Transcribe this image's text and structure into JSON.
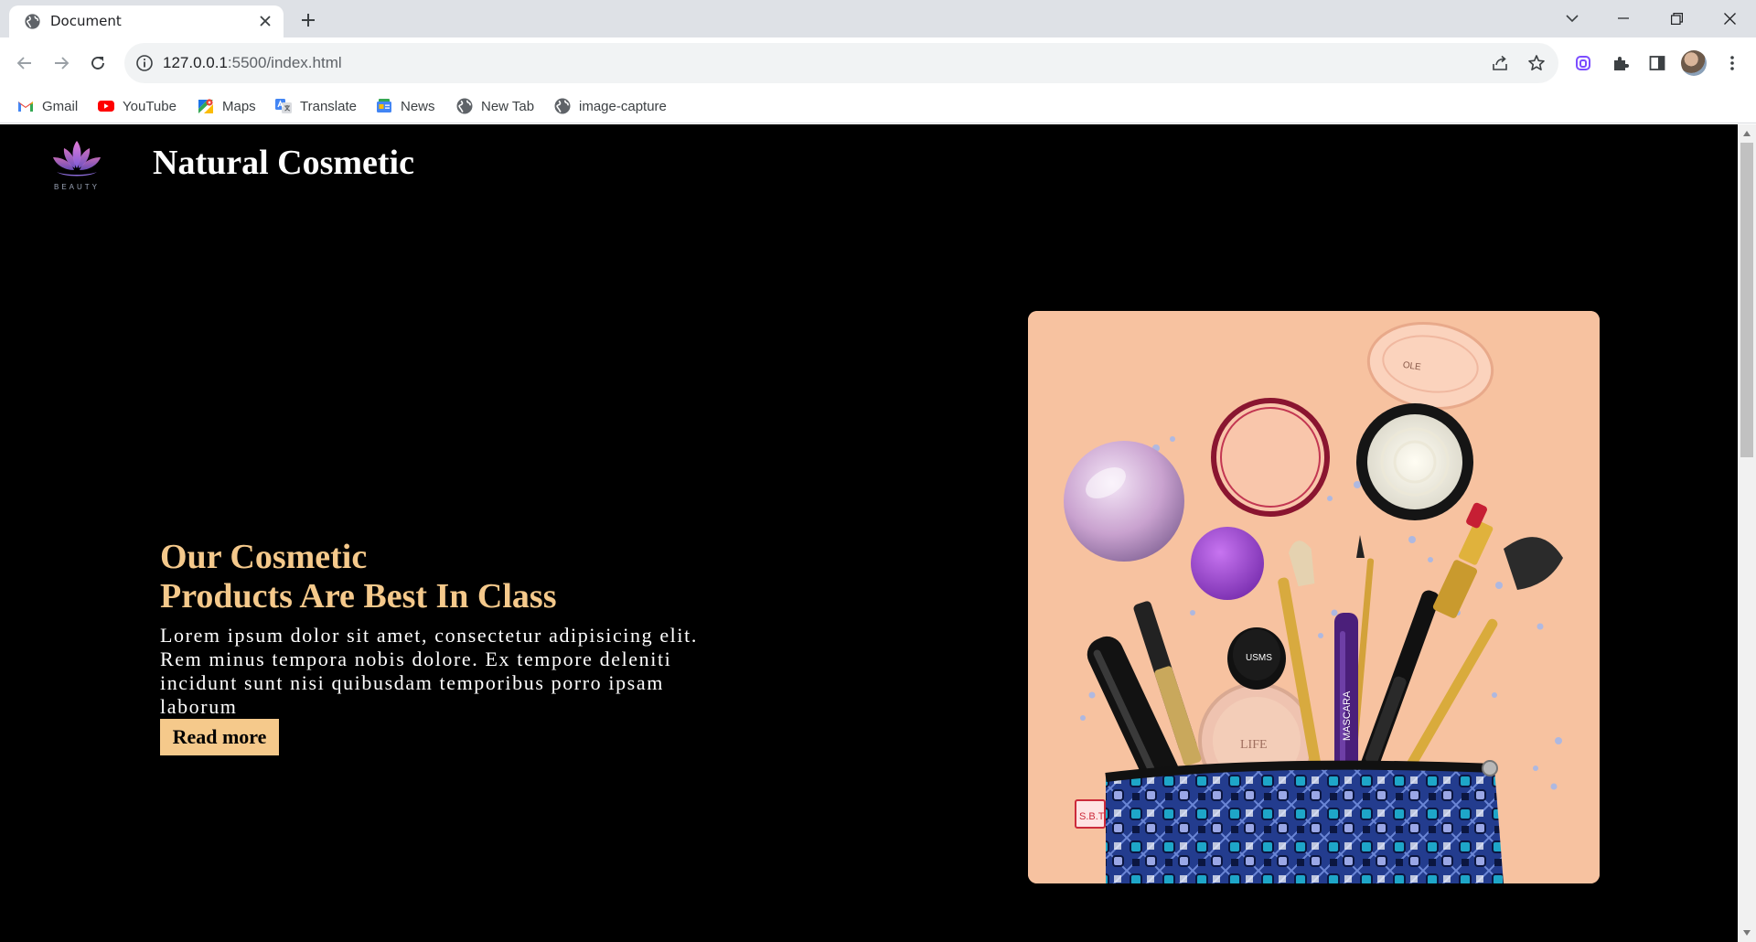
{
  "browser": {
    "tab_title": "Document",
    "url_host": "127.0.0.1",
    "url_path": ":5500/index.html",
    "accent_color": "#7c4dff"
  },
  "bookmarks": [
    {
      "label": "Gmail",
      "icon": "gmail-icon"
    },
    {
      "label": "YouTube",
      "icon": "youtube-icon"
    },
    {
      "label": "Maps",
      "icon": "maps-icon"
    },
    {
      "label": "Translate",
      "icon": "translate-icon"
    },
    {
      "label": "News",
      "icon": "news-icon"
    },
    {
      "label": "New Tab",
      "icon": "globe-icon"
    },
    {
      "label": "image-capture",
      "icon": "globe-icon"
    }
  ],
  "page": {
    "background": "#000000",
    "accent_color": "#f5c98b",
    "logo_text": "BEAUTY",
    "site_title": "Natural Cosmetic",
    "hero": {
      "heading_line1": "Our Cosmetic",
      "heading_line2": "Products Are Best In Class",
      "body": "Lorem ipsum dolor sit amet, consectetur adipisicing elit. Rem minus tempora nobis dolore. Ex tempore deleniti incidunt sunt nisi quibusdam temporibus porro ipsam laborum",
      "button_label": "Read more"
    },
    "image_labels": {
      "pouch_tag": "S.B.T",
      "mascara": "MASCARA",
      "jar": "USMS",
      "compact": "LIFE"
    }
  }
}
